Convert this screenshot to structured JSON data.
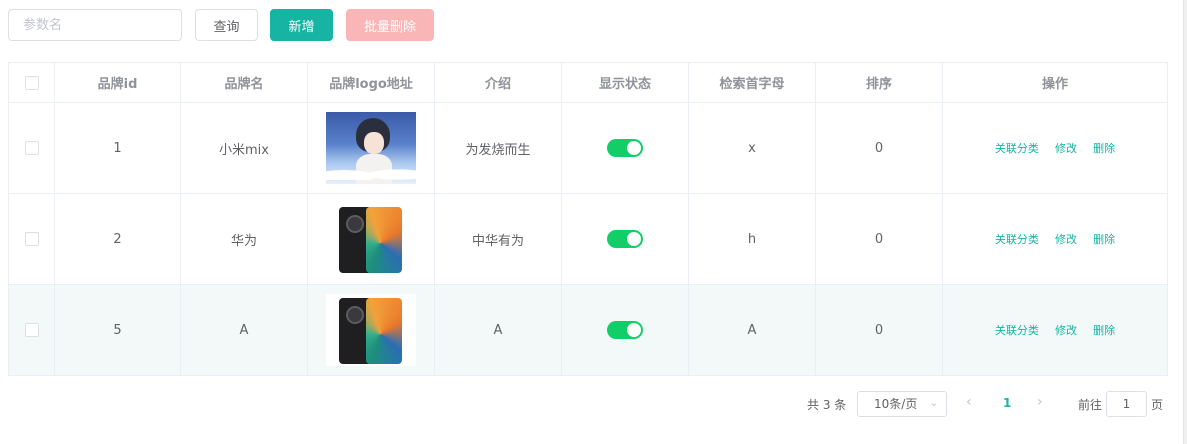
{
  "search": {
    "placeholder": "参数名"
  },
  "buttons": {
    "query": "查询",
    "add": "新增",
    "batch_delete": "批量删除"
  },
  "table": {
    "headers": [
      "品牌id",
      "品牌名",
      "品牌logo地址",
      "介绍",
      "显示状态",
      "检索首字母",
      "排序",
      "操作"
    ],
    "rows": [
      {
        "id": "1",
        "name": "小米mix",
        "logo": "anime-girl-image",
        "intro": "为发烧而生",
        "show_status": true,
        "first_letter": "x",
        "sort": "0"
      },
      {
        "id": "2",
        "name": "华为",
        "logo": "phone-image",
        "intro": "中华有为",
        "show_status": true,
        "first_letter": "h",
        "sort": "0"
      },
      {
        "id": "5",
        "name": "A",
        "logo": "phone-image",
        "intro": "A",
        "show_status": true,
        "first_letter": "A",
        "sort": "0"
      }
    ],
    "ops": {
      "link_category": "关联分类",
      "edit": "修改",
      "delete": "删除"
    }
  },
  "pagination": {
    "total": "共 3 条",
    "page_size": "10条/页",
    "current_page": "1",
    "goto_label": "前往",
    "goto_value": "1",
    "goto_suffix": "页"
  },
  "colors": {
    "accent": "#17b3a3",
    "switch_on": "#13ce66",
    "danger_disabled": "#fab6b6"
  }
}
